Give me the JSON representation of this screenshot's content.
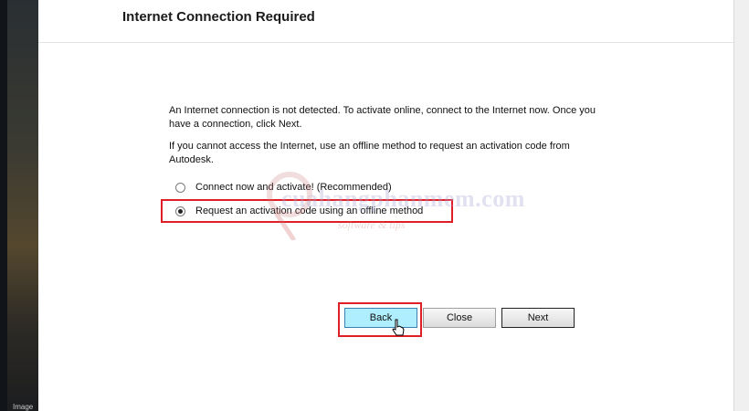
{
  "dialog": {
    "title": "Internet Connection Required",
    "paragraph1": "An Internet connection is not detected. To activate online, connect to the Internet now. Once you have a connection, click Next.",
    "paragraph2": "If you cannot access the Internet, use an offline method to request an activation code from Autodesk."
  },
  "options": [
    {
      "label": "Connect now and activate! (Recommended)",
      "selected": false
    },
    {
      "label": "Request an activation code using an offline method",
      "selected": true
    }
  ],
  "buttons": {
    "back": "Back",
    "close": "Close",
    "next": "Next"
  },
  "watermark": {
    "main": "cuahangphanmem.com",
    "sub": "software & tips"
  },
  "background_label": "Image",
  "colors": {
    "highlight": "#e01e26",
    "back_button_bg": "#aeeefe"
  }
}
